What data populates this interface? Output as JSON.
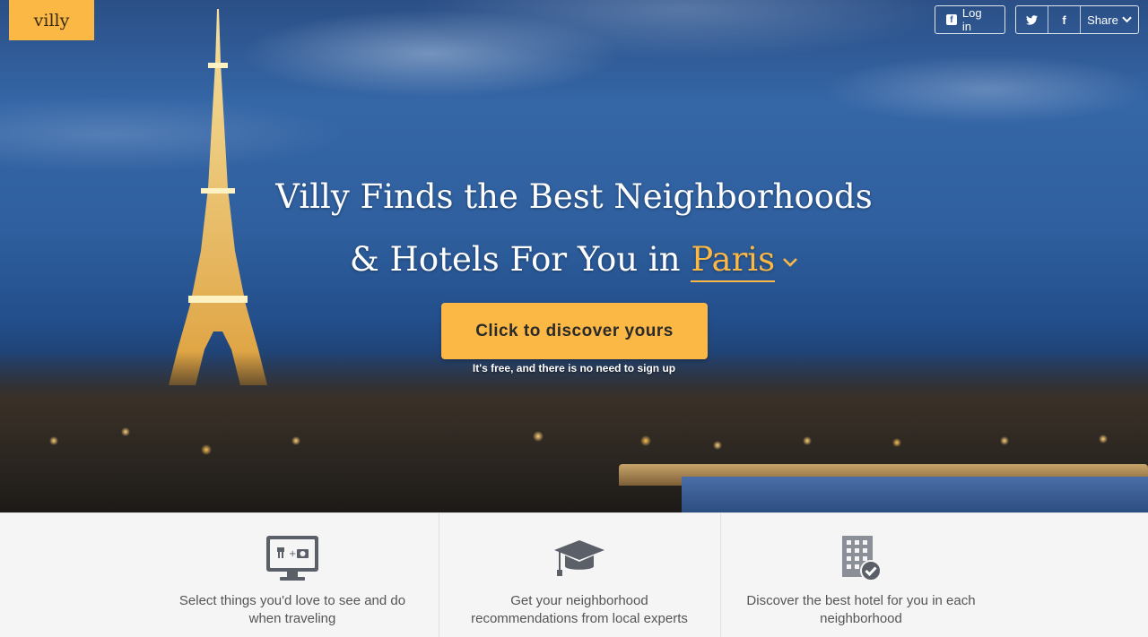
{
  "brand": {
    "name": "villy"
  },
  "header": {
    "login_label": "Log in",
    "twitter_icon": "twitter-icon",
    "facebook_icon": "facebook-icon",
    "share_label": "Share"
  },
  "hero": {
    "headline_line1": "Villy Finds the Best Neighborhoods",
    "headline_line2_prefix": "& Hotels For You in",
    "selected_city": "Paris",
    "cta_label": "Click to discover yours",
    "cta_note": "It's free, and there is no need to sign up"
  },
  "features": [
    {
      "icon": "monitor-food-camera-icon",
      "text": "Select things you'd love to see and do when traveling"
    },
    {
      "icon": "graduation-cap-icon",
      "text": "Get your neighborhood recommendations from local experts"
    },
    {
      "icon": "hotel-building-check-icon",
      "text": "Discover the best hotel for you in each neighborhood"
    }
  ],
  "colors": {
    "accent": "#fbb845",
    "text_dark": "#2a2a2a",
    "feature_text": "#555555"
  }
}
